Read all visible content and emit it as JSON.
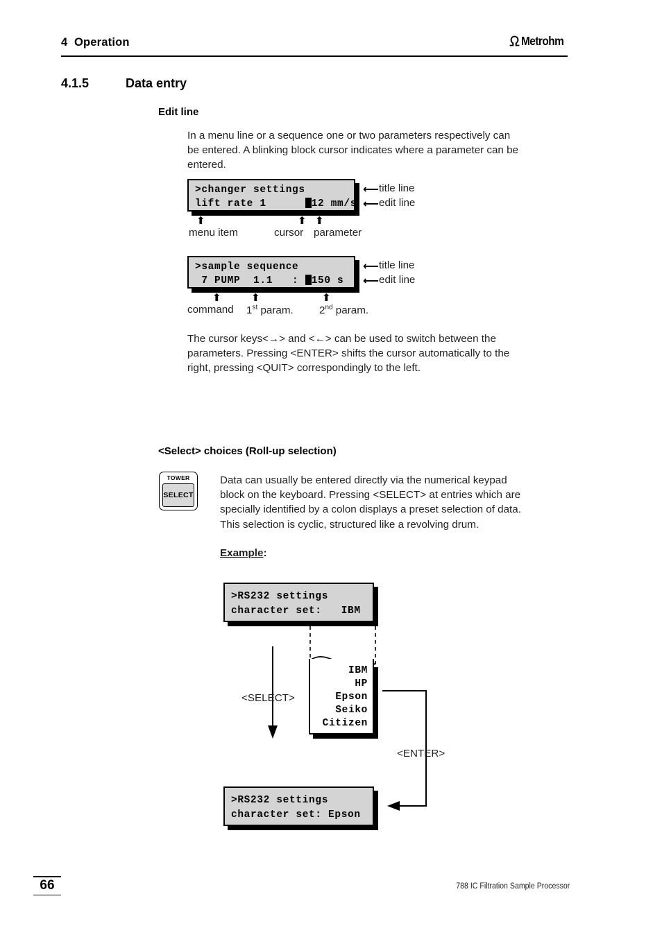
{
  "header": {
    "chapter": "4  Operation",
    "brand": "Metrohm",
    "logo_icon": "metrohm-omega-icon"
  },
  "section": {
    "number": "4.1.5",
    "title": "Data entry"
  },
  "edit_line": {
    "heading": "Edit line",
    "intro": "In a menu line or a sequence one or two parameters respectively can\nbe entered. A blinking block cursor indicates where a parameter can be\nentered.",
    "display1": {
      "title_line": ">changer settings",
      "edit_line_pre": "lift rate 1      ",
      "edit_line_post": "12 mm/s",
      "callout_title": "title line",
      "callout_edit": "edit line",
      "label_menu_item": "menu item",
      "label_cursor": "cursor",
      "label_parameter": "parameter"
    },
    "display2": {
      "title_line": ">sample sequence",
      "edit_line_pre": " 7 PUMP  1.1   : ",
      "edit_line_post": "150 s",
      "callout_title": "title line",
      "callout_edit": "edit line",
      "label_command": "command",
      "label_param1_num": "1",
      "label_param1_sup": "st",
      "label_param1_rest": " param.",
      "label_param2_num": "2",
      "label_param2_sup": "nd",
      "label_param2_rest": " param."
    },
    "cursor_keys_text": "The cursor keys<→> and <←> can be used to switch between the\nparameters. Pressing <ENTER> shifts the cursor automatically to the\nright, pressing <QUIT> correspondingly to the left."
  },
  "select_choices": {
    "heading": "<Select> choices (Roll-up selection)",
    "key": {
      "top_label": "TOWER",
      "button_label": "SELECT"
    },
    "body": "Data can usually be entered directly via the numerical keypad\nblock on the keyboard. Pressing <SELECT> at entries which are\nspecially identified by a colon displays a preset selection of data.\nThis selection is cyclic, structured like a revolving drum.",
    "example_label": "Example",
    "example_colon": ":",
    "diagram": {
      "top_display": {
        "title_line": ">RS232 settings",
        "edit_line": "character set:   IBM"
      },
      "drum_options": [
        "IBM",
        "HP",
        "Epson",
        "Seiko",
        "Citizen"
      ],
      "select_label": "<SELECT>",
      "enter_label": "<ENTER>",
      "bottom_display": {
        "title_line": ">RS232 settings",
        "edit_line": "character set: Epson"
      }
    }
  },
  "footer": {
    "page_number": "66",
    "document_title": "788 IC Filtration Sample Processor"
  },
  "colors": {
    "lcd_background": "#d4d4d4",
    "key_background": "#d9d9d9",
    "text": "#231f20",
    "line": "#000000"
  }
}
